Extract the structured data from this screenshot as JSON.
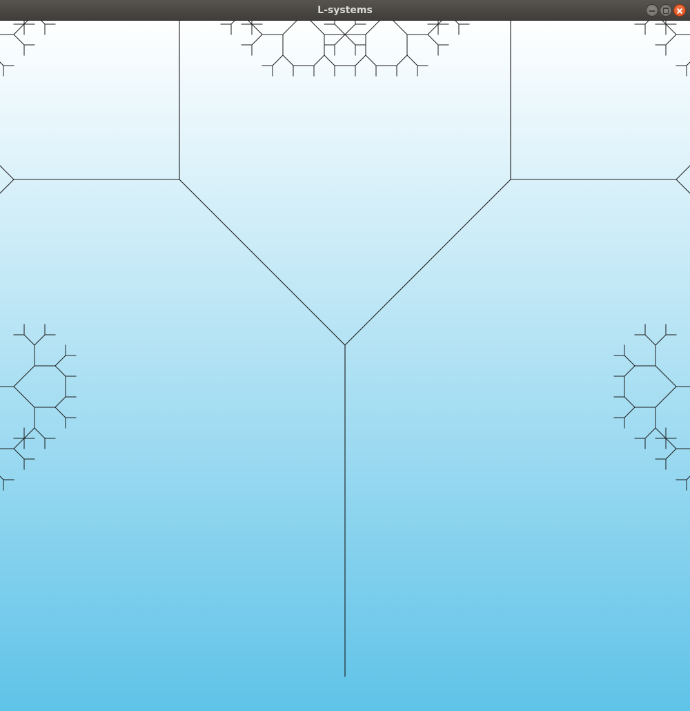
{
  "window": {
    "title": "L-systems",
    "controls": [
      "minimize-icon",
      "maximize-icon",
      "close-icon"
    ]
  },
  "canvas": {
    "background_top": "#ffffff",
    "background_bottom": "#5fc3e8",
    "stroke_color": "#1a1a1a"
  }
}
